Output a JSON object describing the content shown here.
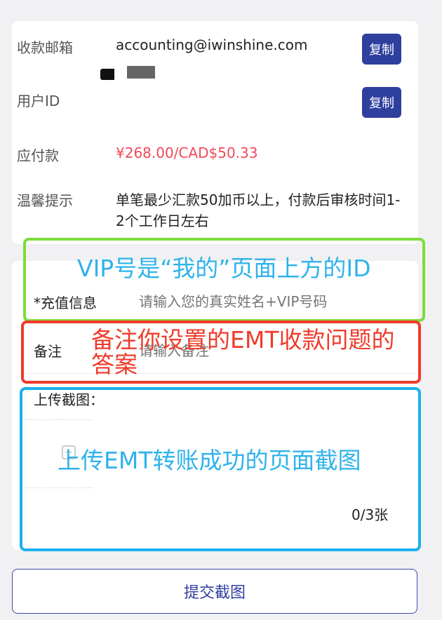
{
  "info": {
    "email_label": "收款邮箱",
    "email_value": "accounting@iwinshine.com",
    "userid_label": "用户ID",
    "copy_label": "复制",
    "amount_label": "应付款",
    "amount_value": "¥268.00/CAD$50.33",
    "tip_label": "温馨提示",
    "tip_value": "单笔最少汇款50加币以上，付款后审核时间1-2个工作日左右"
  },
  "form": {
    "recharge_label": "*充值信息",
    "recharge_placeholder": "请输入您的真实姓名+VIP号码",
    "note_label": "备注",
    "note_placeholder": "请输入备注",
    "upload_label": "上传截图：",
    "upload_count": "0/3张"
  },
  "submit_label": "提交截图",
  "annotations": {
    "green_text": "VIP号是“我的”页面上方的ID",
    "red_text": "备注你设置的EMT收款问题的答案",
    "blue_text": "上传EMT转账成功的页面截图",
    "colors": {
      "green": "#7ddc3a",
      "red": "#ef3b2a",
      "blue": "#1bb0ec"
    }
  },
  "colors": {
    "accent": "#2f3f9e",
    "price": "#f0495a"
  }
}
